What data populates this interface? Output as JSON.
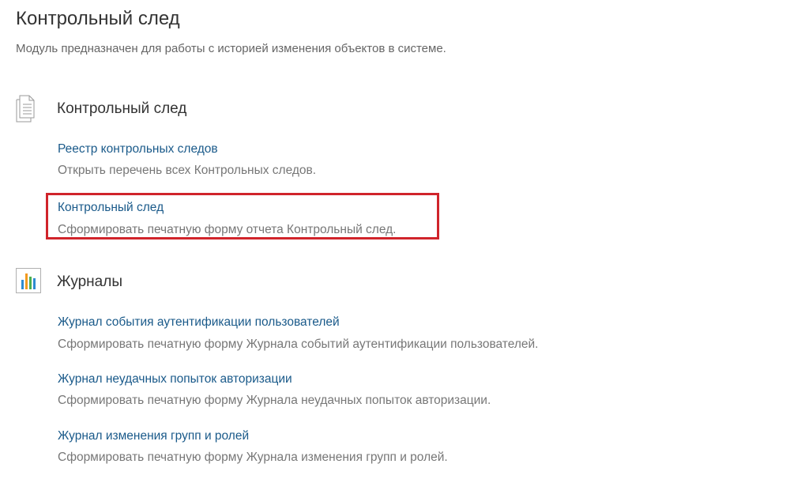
{
  "header": {
    "title": "Контрольный след",
    "description": "Модуль предназначен для работы с историей изменения объектов в системе."
  },
  "sections": [
    {
      "title": "Контрольный след",
      "icon": "document-icon",
      "items": [
        {
          "link": "Реестр контрольных следов",
          "description": "Открыть перечень всех Контрольных следов."
        },
        {
          "link": "Контрольный след",
          "description": "Сформировать печатную форму отчета Контрольный след.",
          "highlighted": true
        }
      ]
    },
    {
      "title": "Журналы",
      "icon": "bar-chart-icon",
      "items": [
        {
          "link": "Журнал события аутентификации пользователей",
          "description": "Сформировать печатную форму Журнала событий аутентификации пользователей."
        },
        {
          "link": "Журнал неудачных попыток авторизации",
          "description": "Сформировать печатную форму Журнала неудачных попыток авторизации."
        },
        {
          "link": "Журнал изменения групп и ролей",
          "description": "Сформировать печатную форму Журнала изменения групп и ролей."
        }
      ]
    }
  ],
  "colors": {
    "link": "#1a5a8a",
    "highlight_border": "#d0242b",
    "chart_bars": [
      "#2e8bd1",
      "#f29a1f",
      "#4caf50",
      "#2e8bd1"
    ]
  }
}
